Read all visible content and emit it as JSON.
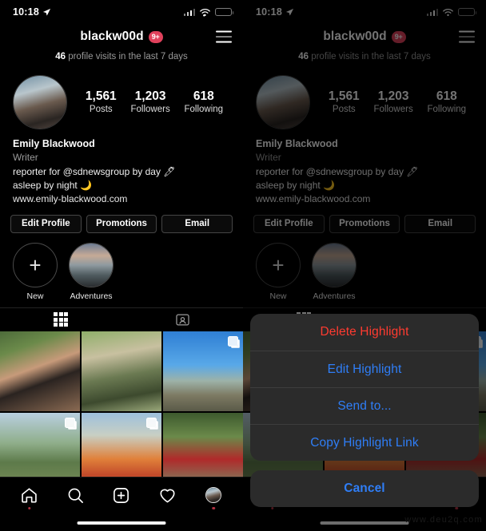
{
  "status_bar": {
    "time": "10:18",
    "location_icon": "location-arrow-icon",
    "cellular_icon": "cellular-signal-icon",
    "wifi_icon": "wifi-icon",
    "battery_icon": "battery-low-power-icon",
    "battery_color": "#e8b23a"
  },
  "header": {
    "username": "blackw00d",
    "badge": "9+",
    "badge_color": "#e0415c",
    "menu_icon": "hamburger-menu-icon"
  },
  "visits": {
    "count": "46",
    "text": " profile visits in the last 7 days"
  },
  "profile": {
    "avatar_icon": "profile-avatar",
    "stats": [
      {
        "value": "1,561",
        "label": "Posts"
      },
      {
        "value": "1,203",
        "label": "Followers"
      },
      {
        "value": "618",
        "label": "Following"
      }
    ],
    "name": "Emily Blackwood",
    "category": "Writer",
    "bio_line_1": "reporter for @sdnewsgroup by day 🖊",
    "bio_line_2": "asleep by night 🌙",
    "website": "www.emily-blackwood.com"
  },
  "actions": {
    "edit_profile": "Edit Profile",
    "promotions": "Promotions",
    "email": "Email"
  },
  "highlights": [
    {
      "label": "New",
      "icon": "plus-icon",
      "type": "new"
    },
    {
      "label": "Adventures",
      "icon": "coast-highlight-cover",
      "type": "cover"
    }
  ],
  "tabs": [
    {
      "name": "grid-tab",
      "icon": "grid-icon",
      "active": true
    },
    {
      "name": "tagged-tab",
      "icon": "tagged-person-icon",
      "active": false
    }
  ],
  "photo_grid": {
    "rows": 2,
    "cols": 3,
    "cells": [
      {
        "icon": "photo-portrait-plants",
        "multi": false
      },
      {
        "icon": "photo-street-hat",
        "multi": false
      },
      {
        "icon": "photo-hilltop",
        "multi": true
      },
      {
        "icon": "photo-couple-field",
        "multi": true
      },
      {
        "icon": "photo-flower-field",
        "multi": true
      },
      {
        "icon": "photo-red-shirt-couple",
        "multi": false
      }
    ]
  },
  "bottom_nav": [
    {
      "name": "home-tab",
      "icon": "home-icon",
      "dot": true
    },
    {
      "name": "search-tab",
      "icon": "search-icon",
      "dot": false
    },
    {
      "name": "create-tab",
      "icon": "plus-square-icon",
      "dot": false
    },
    {
      "name": "activity-tab",
      "icon": "heart-icon",
      "dot": false
    },
    {
      "name": "profile-tab",
      "icon": "profile-avatar-icon",
      "dot": true
    }
  ],
  "action_sheet": {
    "items": [
      {
        "label": "Delete Highlight",
        "style": "destructive",
        "color": "#ff3b30"
      },
      {
        "label": "Edit Highlight",
        "style": "normal",
        "color": "#2f7ef7"
      },
      {
        "label": "Send to...",
        "style": "normal",
        "color": "#2f7ef7"
      },
      {
        "label": "Copy Highlight Link",
        "style": "normal",
        "color": "#2f7ef7"
      }
    ],
    "cancel": "Cancel"
  },
  "watermark": "www.deu2q.com"
}
